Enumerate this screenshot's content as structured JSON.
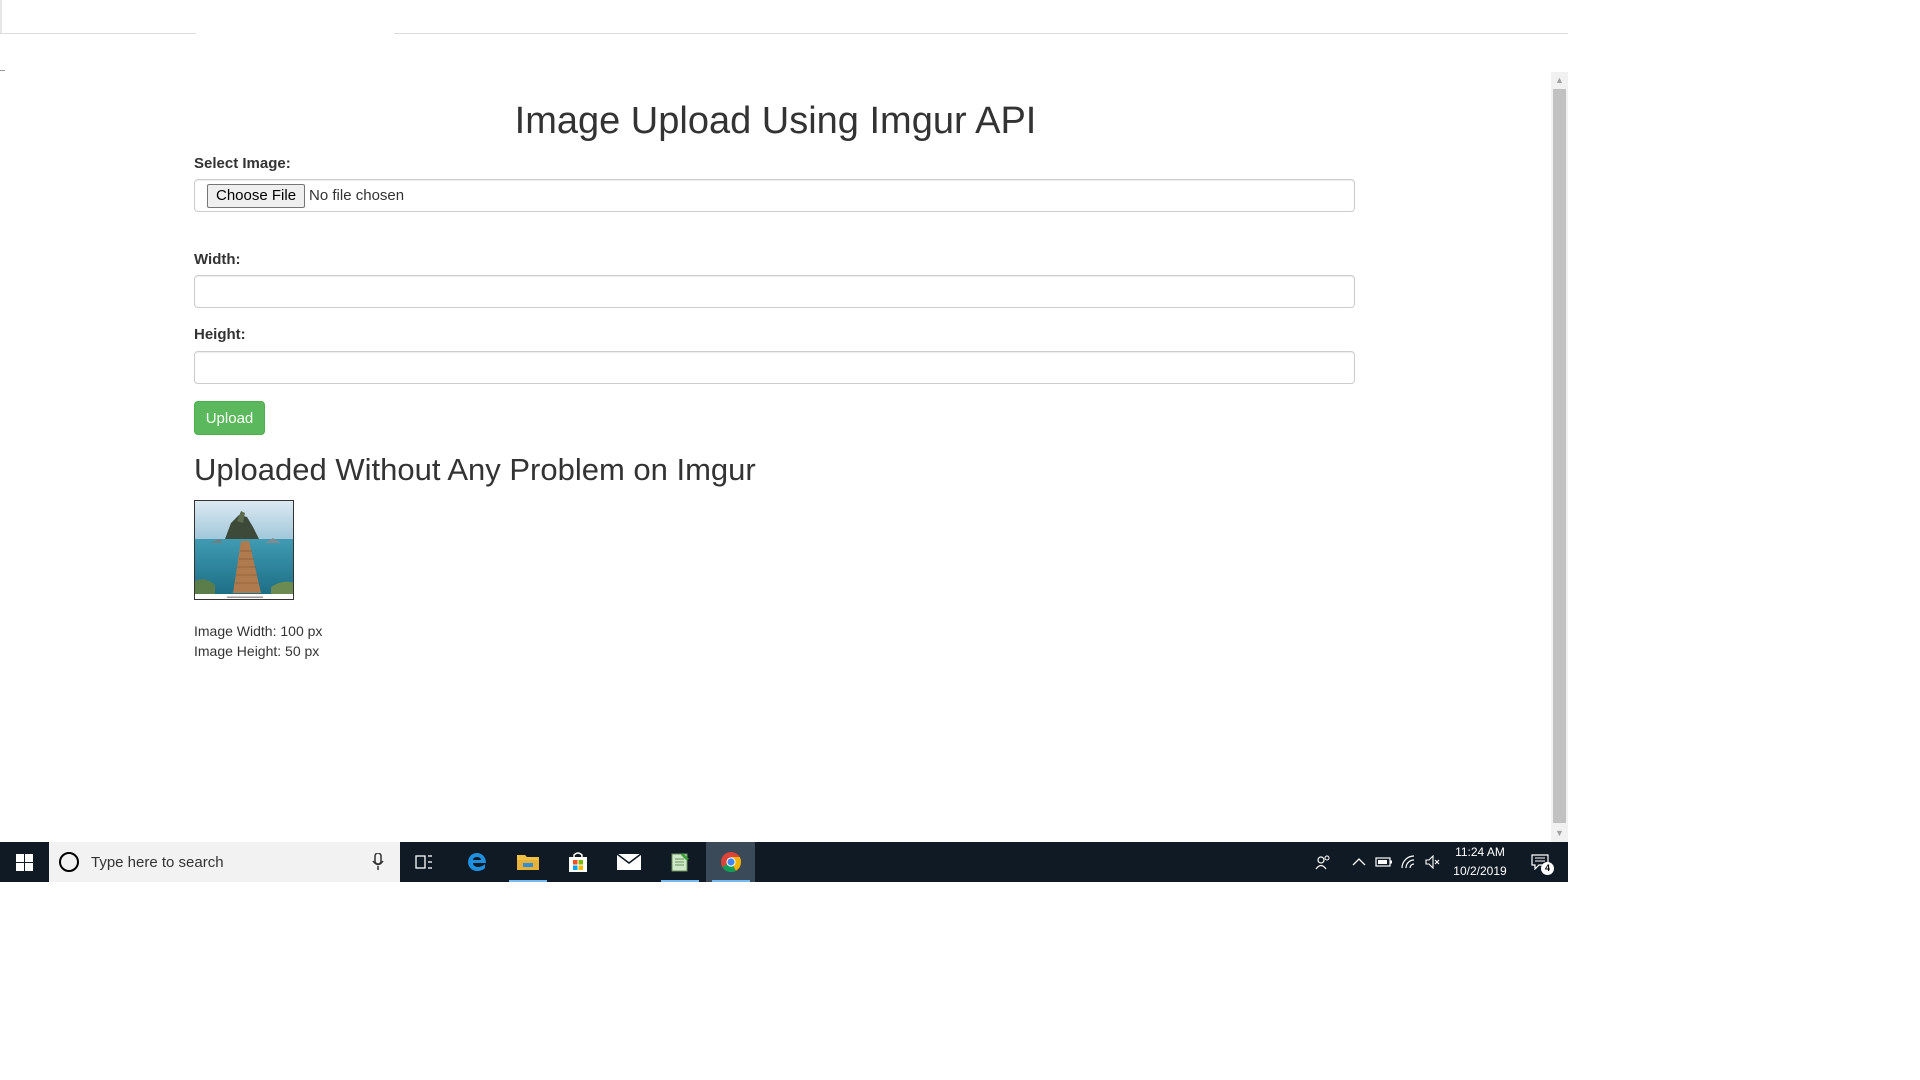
{
  "page": {
    "title": "Image Upload Using Imgur API",
    "select_image_label": "Select Image:",
    "choose_file_label": "Choose File",
    "file_status": "No file chosen",
    "width_label": "Width:",
    "width_value": "",
    "height_label": "Height:",
    "height_value": "",
    "upload_label": "Upload",
    "result_heading": "Uploaded Without Any Problem on Imgur",
    "image_width_text": "Image Width: 100 px",
    "image_height_text": "Image Height: 50 px"
  },
  "taskbar": {
    "search_placeholder": "Type here to search",
    "time": "11:24 AM",
    "date": "10/2/2019",
    "notification_count": "4",
    "apps": [
      "task-view-icon",
      "edge-icon",
      "file-explorer-icon",
      "store-icon",
      "mail-icon",
      "notepad-icon",
      "chrome-icon"
    ]
  },
  "colors": {
    "upload_button": "#5cb85c",
    "taskbar": "#101a24"
  }
}
